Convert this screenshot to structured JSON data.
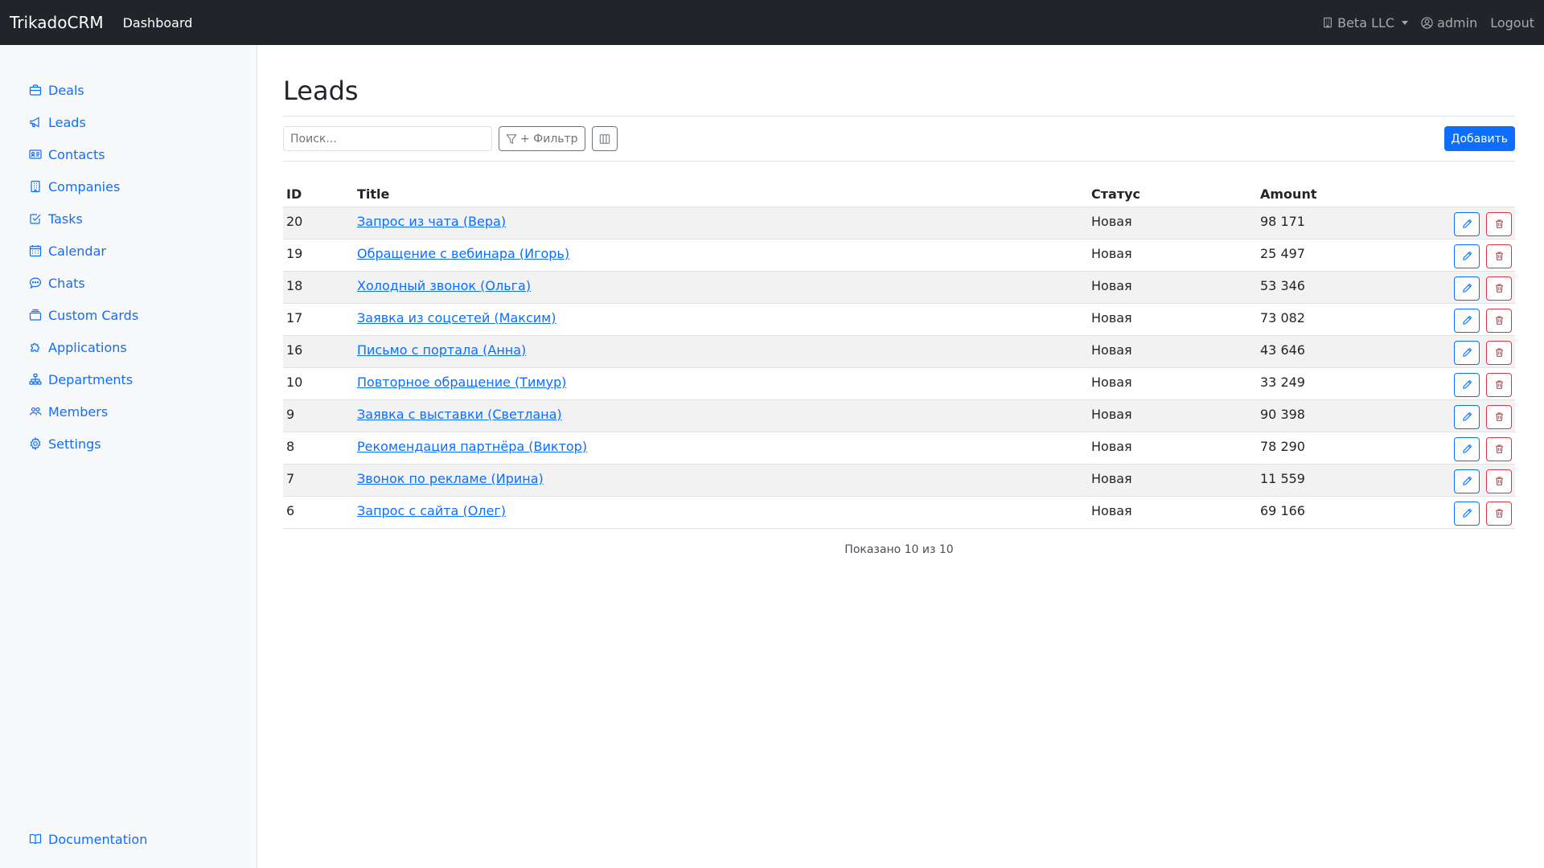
{
  "navbar": {
    "brand": "TrikadoCRM",
    "dashboard_link": "Dashboard",
    "company": "Beta LLC",
    "user": "admin",
    "logout": "Logout"
  },
  "sidebar": {
    "items": [
      {
        "label": "Deals",
        "icon": "briefcase-icon"
      },
      {
        "label": "Leads",
        "icon": "megaphone-icon"
      },
      {
        "label": "Contacts",
        "icon": "person-card-icon"
      },
      {
        "label": "Companies",
        "icon": "building-icon"
      },
      {
        "label": "Tasks",
        "icon": "check-square-icon"
      },
      {
        "label": "Calendar",
        "icon": "calendar-icon"
      },
      {
        "label": "Chats",
        "icon": "chat-icon"
      },
      {
        "label": "Custom Cards",
        "icon": "card-stack-icon"
      },
      {
        "label": "Applications",
        "icon": "puzzle-icon"
      },
      {
        "label": "Departments",
        "icon": "diagram-icon"
      },
      {
        "label": "Members",
        "icon": "people-icon"
      },
      {
        "label": "Settings",
        "icon": "gear-icon"
      }
    ],
    "documentation": "Documentation"
  },
  "main": {
    "title": "Leads",
    "search_placeholder": "Поиск...",
    "filter_label": "+ Фильтр",
    "add_label": "Добавить",
    "columns": {
      "id": "ID",
      "title": "Title",
      "status": "Статус",
      "amount": "Amount"
    },
    "rows": [
      {
        "id": "20",
        "title": "Запрос из чата (Вера)",
        "status": "Новая",
        "amount": "98 171"
      },
      {
        "id": "19",
        "title": "Обращение с вебинара (Игорь)",
        "status": "Новая",
        "amount": "25 497"
      },
      {
        "id": "18",
        "title": "Холодный звонок (Ольга)",
        "status": "Новая",
        "amount": "53 346"
      },
      {
        "id": "17",
        "title": "Заявка из соцсетей (Максим)",
        "status": "Новая",
        "amount": "73 082"
      },
      {
        "id": "16",
        "title": "Письмо с портала (Анна)",
        "status": "Новая",
        "amount": "43 646"
      },
      {
        "id": "10",
        "title": "Повторное обращение (Тимур)",
        "status": "Новая",
        "amount": "33 249"
      },
      {
        "id": "9",
        "title": "Заявка с выставки (Светлана)",
        "status": "Новая",
        "amount": "90 398"
      },
      {
        "id": "8",
        "title": "Рекомендация партнёра (Виктор)",
        "status": "Новая",
        "amount": "78 290"
      },
      {
        "id": "7",
        "title": "Звонок по рекламе (Ирина)",
        "status": "Новая",
        "amount": "11 559"
      },
      {
        "id": "6",
        "title": "Запрос с сайта (Олег)",
        "status": "Новая",
        "amount": "69 166"
      }
    ],
    "footer": "Показано 10 из 10"
  },
  "colors": {
    "navbar_bg": "#212529",
    "link": "#0d6efd",
    "danger": "#dc3545",
    "sidebar_bg": "#f8f9fa"
  }
}
